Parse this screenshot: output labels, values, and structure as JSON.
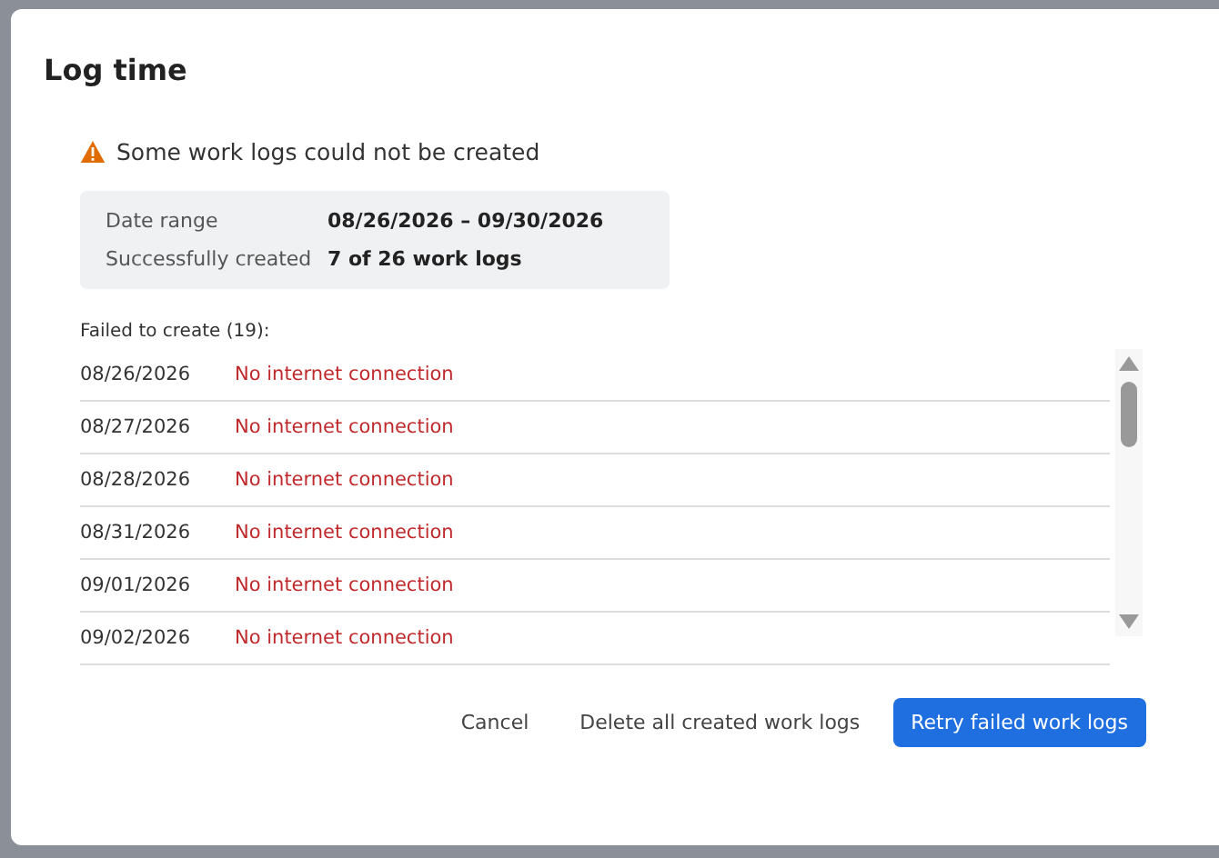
{
  "dialog": {
    "title": "Log time"
  },
  "alert": {
    "message": "Some work logs could not be created"
  },
  "summary": [
    {
      "label": "Date range",
      "value": "08/26/2026 – 09/30/2026"
    },
    {
      "label": "Successfully created",
      "value": "7 of 26 work logs"
    }
  ],
  "failures": {
    "heading": "Failed to create (19):",
    "rows": [
      {
        "date": "08/26/2026",
        "error": "No internet connection"
      },
      {
        "date": "08/27/2026",
        "error": "No internet connection"
      },
      {
        "date": "08/28/2026",
        "error": "No internet connection"
      },
      {
        "date": "08/31/2026",
        "error": "No internet connection"
      },
      {
        "date": "09/01/2026",
        "error": "No internet connection"
      },
      {
        "date": "09/02/2026",
        "error": "No internet connection"
      }
    ]
  },
  "buttons": [
    {
      "label": "Cancel",
      "kind": "text"
    },
    {
      "label": "Delete all created work logs",
      "kind": "text"
    },
    {
      "label": "Retry failed work logs",
      "kind": "primary"
    }
  ]
}
